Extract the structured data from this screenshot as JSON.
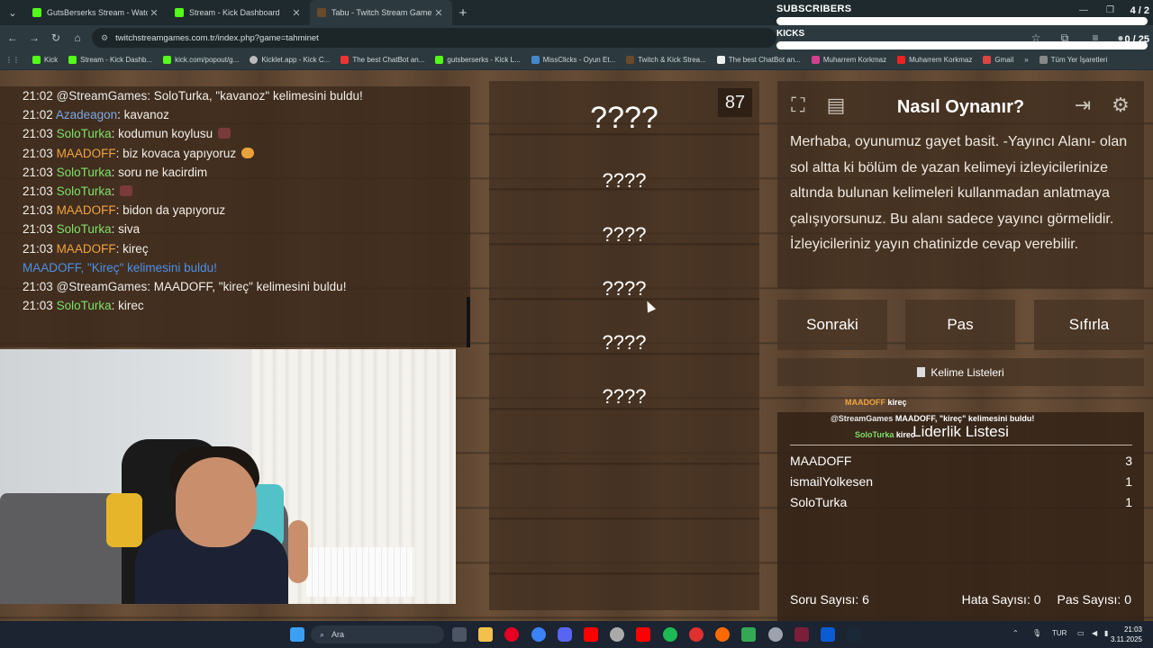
{
  "browser": {
    "tabs": [
      {
        "label": "GutsBerserks Stream - Watch L",
        "icon": "kick-icon",
        "active": false
      },
      {
        "label": "Stream - Kick Dashboard",
        "icon": "kick-icon",
        "active": false
      },
      {
        "label": "Tabu - Twitch Stream Game",
        "icon": "tabu-icon",
        "active": true
      }
    ],
    "new_tab": "+",
    "url": "twitchstreamgames.com.tr/index.php?game=tahminet",
    "bookmarks": [
      "Kick",
      "Stream - Kick Dashb...",
      "kick.com/popout/g...",
      "Kicklet.app - Kick C...",
      "The best ChatBot an...",
      "gutsberserks - Kick L...",
      "MissClicks - Oyun Et...",
      "Twitch & Kick Strea...",
      "The best ChatBot an...",
      "Muharrem Korkmaz",
      "Muharrem Korkmaz",
      "Gmail",
      "»",
      "Tüm Yer İşaretleri"
    ]
  },
  "overlay": {
    "subscribers_label": "SUBSCRIBERS",
    "subscribers_count": "4 / 2",
    "kicks_label": "KICKS",
    "kicks_count": "0 / 25"
  },
  "chat": {
    "colors": {
      "streamgames": "#e8e8e8",
      "azadeagon": "#7aa7e6",
      "soloturka": "#7ee06a",
      "maadoff": "#f0a340",
      "system": "#4a90e8"
    },
    "lines": [
      {
        "time": "21:02",
        "user": "@StreamGames",
        "color": "#e8e8e8",
        "msg": ": SoloTurka, \"kavanoz\" kelimesini buldu!"
      },
      {
        "time": "21:02",
        "user": "Azadeagon",
        "color": "#7aa7e6",
        "msg": ": kavanoz"
      },
      {
        "time": "21:03",
        "user": "SoloTurka",
        "color": "#7ee06a",
        "msg": ": kodumun koylusu"
      },
      {
        "time": "21:03",
        "user": "MAADOFF",
        "color": "#f0a340",
        "msg": ": biz kovaca yapıyoruz"
      },
      {
        "time": "21:03",
        "user": "SoloTurka",
        "color": "#7ee06a",
        "msg": ": soru ne kacirdim"
      },
      {
        "time": "21:03",
        "user": "SoloTurka",
        "color": "#7ee06a",
        "msg": ":"
      },
      {
        "time": "21:03",
        "user": "MAADOFF",
        "color": "#f0a340",
        "msg": ": bidon da yapıyoruz"
      },
      {
        "time": "21:03",
        "user": "SoloTurka",
        "color": "#7ee06a",
        "msg": ": siva"
      },
      {
        "time": "21:03",
        "user": "MAADOFF",
        "color": "#f0a340",
        "msg": ": kireç"
      },
      {
        "time": "",
        "user": "",
        "color": "#4a90e8",
        "msg": "MAADOFF, \"Kireç\" kelimesini buldu!"
      },
      {
        "time": "21:03",
        "user": "@StreamGames",
        "color": "#e8e8e8",
        "msg": ": MAADOFF, \"kireç\" kelimesini buldu!"
      },
      {
        "time": "21:03",
        "user": "SoloTurka",
        "color": "#7ee06a",
        "msg": ": kirec"
      }
    ]
  },
  "game": {
    "timer": "87",
    "main_word": "????",
    "taboo_words": [
      "????",
      "????",
      "????",
      "????",
      "????"
    ]
  },
  "howto": {
    "title": "Nasıl Oynanır?",
    "description": "Merhaba, oyunumuz gayet basit. -Yayıncı Alanı- olan sol altta ki bölüm de yazan kelimeyi izleyicilerinize altında bulunan kelimeleri kullanmadan anlatmaya çalışıyorsunuz. Bu alanı sadece yayıncı görmelidir. İzleyicileriniz yayın chatinizde cevap verebilir."
  },
  "controls": {
    "next": "Sonraki",
    "pass": "Pas",
    "reset": "Sıfırla",
    "word_lists": "Kelime Listeleri"
  },
  "leaderboard": {
    "title": "Liderlik Listesi",
    "rows": [
      {
        "name": "MAADOFF",
        "score": "3"
      },
      {
        "name": "ismailYolkesen",
        "score": "1"
      },
      {
        "name": "SoloTurka",
        "score": "1"
      }
    ],
    "stats": {
      "questions": "Soru Sayısı: 6",
      "errors": "Hata Sayısı: 0",
      "passes": "Pas Sayısı: 0"
    }
  },
  "overlay_chat": [
    {
      "user": "MAADOFF",
      "color": "#f0a340",
      "msg": "kireç"
    },
    {
      "user": "@StreamGames",
      "color": "#e8e8e8",
      "msg": "MAADOFF, \"kireç\" kelimesini buldu!"
    },
    {
      "user": "SoloTurka",
      "color": "#7ee06a",
      "msg": "kirec"
    }
  ],
  "taskbar": {
    "search_placeholder": "Ara",
    "language": "TUR",
    "time": "21:03",
    "date": "3.11.2025"
  }
}
